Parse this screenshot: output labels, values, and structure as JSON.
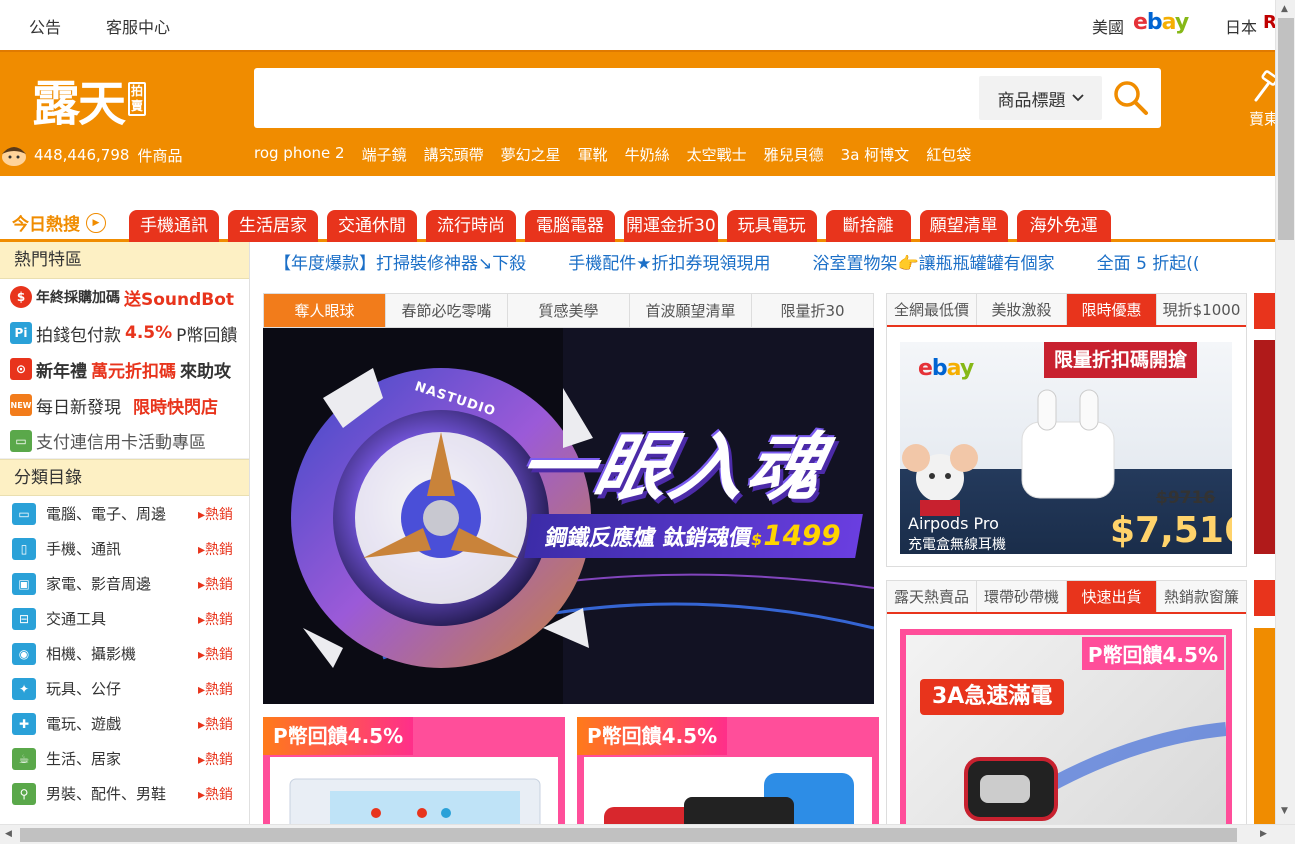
{
  "topbar": {
    "announcement": "公告",
    "service": "客服中心",
    "usa_label": "美國",
    "ebay_letters": [
      "e",
      "b",
      "a",
      "y"
    ],
    "japan_label": "日本",
    "japan_logo_letter": "R"
  },
  "header": {
    "logo_text": "露天",
    "logo_badge": "拍賣",
    "search_placeholder": "",
    "search_scope": "商品標題",
    "product_count": "448,446,798",
    "product_count_unit": "件商品",
    "cart_label": "賣東",
    "hot_keywords": [
      "rog phone 2",
      "端子鏡",
      "講究頭帶",
      "夢幻之星",
      "軍靴",
      "牛奶絲",
      "太空戰士",
      "雅兒貝德",
      "3a 柯博文",
      "紅包袋"
    ]
  },
  "category_tabs": {
    "today_hot": "今日熱搜",
    "items": [
      "手機通訊",
      "生活居家",
      "交通休閒",
      "流行時尚",
      "電腦電器",
      "開運金折30",
      "玩具電玩",
      "斷捨離",
      "願望清單",
      "海外免運"
    ]
  },
  "sidebar": {
    "hot_zone_title": "熱門特區",
    "promos": [
      {
        "text": "年終採購加碼",
        "highlight": "送SoundBot",
        "icon": "money-bag-icon",
        "color": "#e8341c"
      },
      {
        "text": "拍錢包付款",
        "highlight": "4.5%",
        "suffix": "P幣回饋",
        "icon": "pi-wallet-icon",
        "color": "#2aa1d8"
      },
      {
        "text": "新年禮",
        "highlight": "萬元折扣碼",
        "suffix": "來助攻",
        "icon": "gift-icon",
        "color": "#e8341c"
      },
      {
        "text": "每日新發現",
        "highlight": "限時快閃店",
        "icon": "new-badge-icon",
        "color": "#f27c1b"
      },
      {
        "text": "支付連信用卡活動專區",
        "highlight": "",
        "icon": "credit-card-icon",
        "color": "#5aa84a"
      }
    ],
    "category_title": "分類目錄",
    "categories": [
      {
        "label": "電腦、電子、周邊",
        "icon": "computer-icon"
      },
      {
        "label": "手機、通訊",
        "icon": "mobile-phone-icon"
      },
      {
        "label": "家電、影音周邊",
        "icon": "tv-icon"
      },
      {
        "label": "交通工具",
        "icon": "car-icon"
      },
      {
        "label": "相機、攝影機",
        "icon": "camera-icon"
      },
      {
        "label": "玩具、公仔",
        "icon": "toy-icon"
      },
      {
        "label": "電玩、遊戲",
        "icon": "gamepad-icon"
      },
      {
        "label": "生活、居家",
        "icon": "home-icon"
      },
      {
        "label": "男裝、配件、男鞋",
        "icon": "menswear-icon"
      }
    ],
    "hot_label": "熱銷"
  },
  "marquee": [
    "【年度爆款】打掃裝修神器↘下殺",
    "手機配件★折扣券現領現用",
    "浴室置物架👉讓瓶瓶罐罐有個家",
    "全面 5 折起(("
  ],
  "main": {
    "tabs": [
      "奪人眼球",
      "春節必吃零嘴",
      "質感美學",
      "首波願望清單",
      "限量折30"
    ],
    "active_tab": 0,
    "banner": {
      "brand": "NASTUDIO",
      "headline": "一眼入魂",
      "subtitle": "鋼鐵反應爐 鈦銷魂價",
      "currency": "$",
      "price": "1499"
    },
    "promo_cards": [
      {
        "tag": "P幣回饋4.5%"
      },
      {
        "tag": "P幣回饋4.5%"
      }
    ]
  },
  "right_panel_1": {
    "tabs": [
      "全網最低價",
      "美妝激殺",
      "限時優惠",
      "現折$1000"
    ],
    "active_tab": 2,
    "ad": {
      "brand": "ebay",
      "headline": "限量折扣碼開搶",
      "original_price": "$9716",
      "product_name": "Airpods Pro",
      "product_desc": "充電盒無線耳機",
      "price": "$7,516"
    }
  },
  "right_panel_2": {
    "tabs": [
      "露天熱賣品",
      "環帶砂帶機",
      "快速出貨",
      "熱銷款窗簾"
    ],
    "active_tab": 2,
    "ad": {
      "tag": "P幣回饋4.5%",
      "headline": "3A急速滿電"
    }
  },
  "colors": {
    "brand_orange": "#f08c00",
    "tab_red": "#e8341c",
    "link_blue": "#1b6fc7",
    "sidebar_head": "#fdf0c4"
  }
}
